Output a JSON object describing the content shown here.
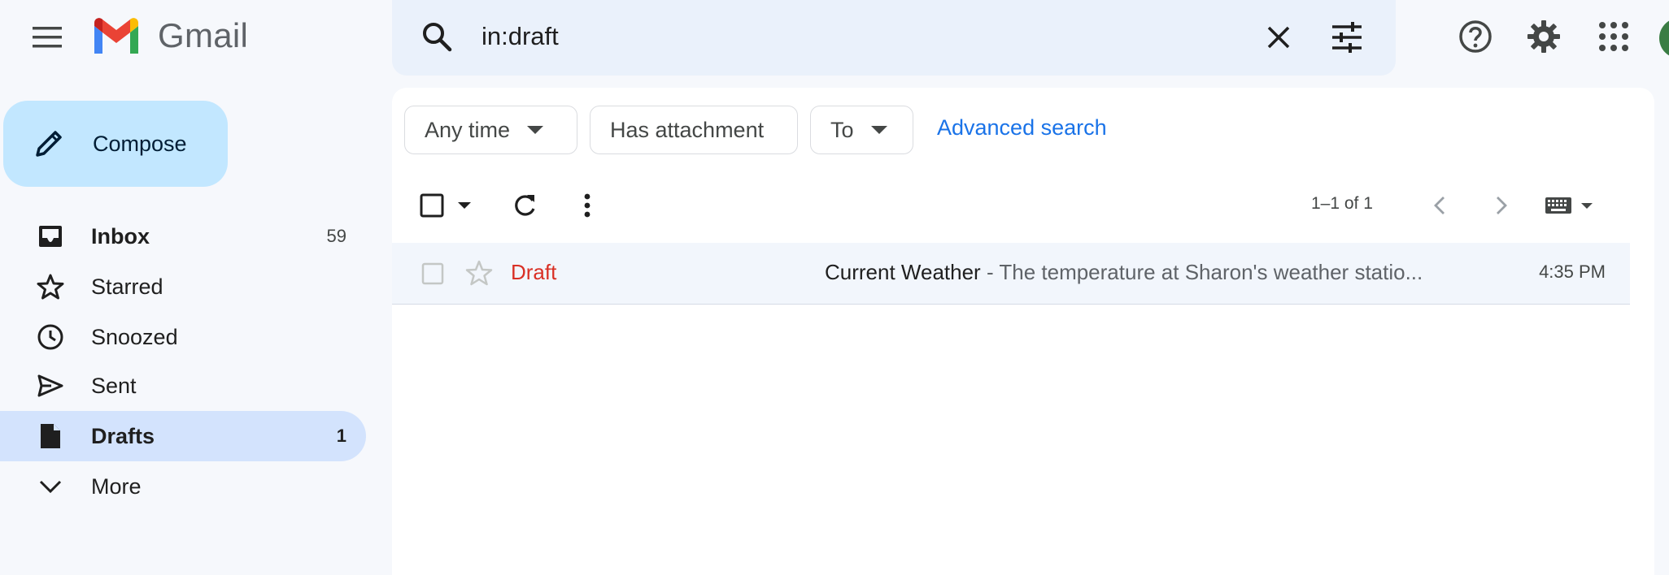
{
  "app": {
    "name": "Gmail"
  },
  "search": {
    "query": "in:draft"
  },
  "sidebar": {
    "compose_label": "Compose",
    "items": [
      {
        "label": "Inbox",
        "count": "59",
        "icon": "inbox-icon"
      },
      {
        "label": "Starred",
        "count": "",
        "icon": "star-icon"
      },
      {
        "label": "Snoozed",
        "count": "",
        "icon": "clock-icon"
      },
      {
        "label": "Sent",
        "count": "",
        "icon": "send-icon"
      },
      {
        "label": "Drafts",
        "count": "1",
        "icon": "draft-icon"
      },
      {
        "label": "More",
        "count": "",
        "icon": "chevron-down-icon"
      }
    ]
  },
  "filters": {
    "any_time": "Any time",
    "has_attachment": "Has attachment",
    "to": "To",
    "advanced_search": "Advanced search"
  },
  "toolbar": {
    "count_text": "1–1 of 1"
  },
  "messages": [
    {
      "sender": "Draft",
      "subject": "Current Weather",
      "snippet": " - The temperature at Sharon's weather statio...",
      "time": "4:35 PM"
    }
  ],
  "colors": {
    "accent": "#1a73e8",
    "compose_bg": "#c2e7ff",
    "active_nav_bg": "#d3e3fd",
    "draft_label": "#d93025",
    "search_bg": "#eaf1fb",
    "page_bg": "#f6f8fc"
  }
}
